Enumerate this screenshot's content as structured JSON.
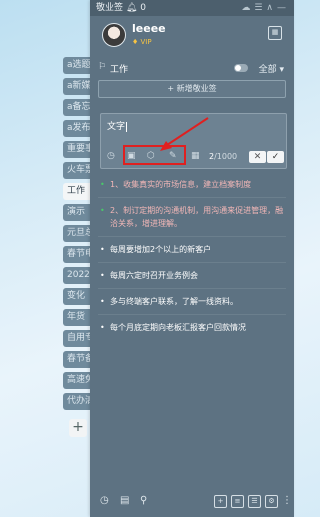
{
  "window": {
    "title": "敬业签 ",
    "bell_count": "0"
  },
  "side_tabs": [
    {
      "label": "a选题"
    },
    {
      "label": "a新媒"
    },
    {
      "label": "a备忘"
    },
    {
      "label": "a发布"
    },
    {
      "label": "重要事"
    },
    {
      "label": "火车票"
    },
    {
      "label": "工作",
      "active": true
    },
    {
      "label": "演示"
    },
    {
      "label": "元旦总"
    },
    {
      "label": "春节电"
    },
    {
      "label": "2022"
    },
    {
      "label": "变化"
    },
    {
      "label": "年货"
    },
    {
      "label": "自用专"
    },
    {
      "label": "春节备"
    },
    {
      "label": "高速免"
    },
    {
      "label": "代办清"
    }
  ],
  "side_add_label": "+",
  "user": {
    "name": "leeee",
    "badge": "VIP"
  },
  "section": {
    "name": "工作",
    "filter": "全部"
  },
  "new_note_button": "+ 新增敬业签",
  "editor": {
    "text": "文字",
    "count": "2",
    "max": "/1000",
    "cancel_label": "✕",
    "confirm_label": "✓"
  },
  "notes": [
    {
      "text": "1、收集真实的市场信息，建立档案制度",
      "red": true
    },
    {
      "text": "2、制订定期的沟通机制，用沟通来促进管理，融洽关系，增进理解。",
      "red": true
    },
    {
      "text": "每周要增加2个以上的新客户",
      "red": false
    },
    {
      "text": "每周六定时召开业务例会",
      "red": false
    },
    {
      "text": "多与终端客户联系，了解一线资料。",
      "red": false
    },
    {
      "text": "每个月底定期向老板汇报客户回款情况",
      "red": false
    }
  ],
  "colors": {
    "panel_bg": "#5d7282",
    "highlight": "#e02020",
    "vip": "#f6c343"
  },
  "icons": {
    "clock": "clock-icon",
    "calendar": "calendar-icon",
    "search": "search-icon"
  }
}
